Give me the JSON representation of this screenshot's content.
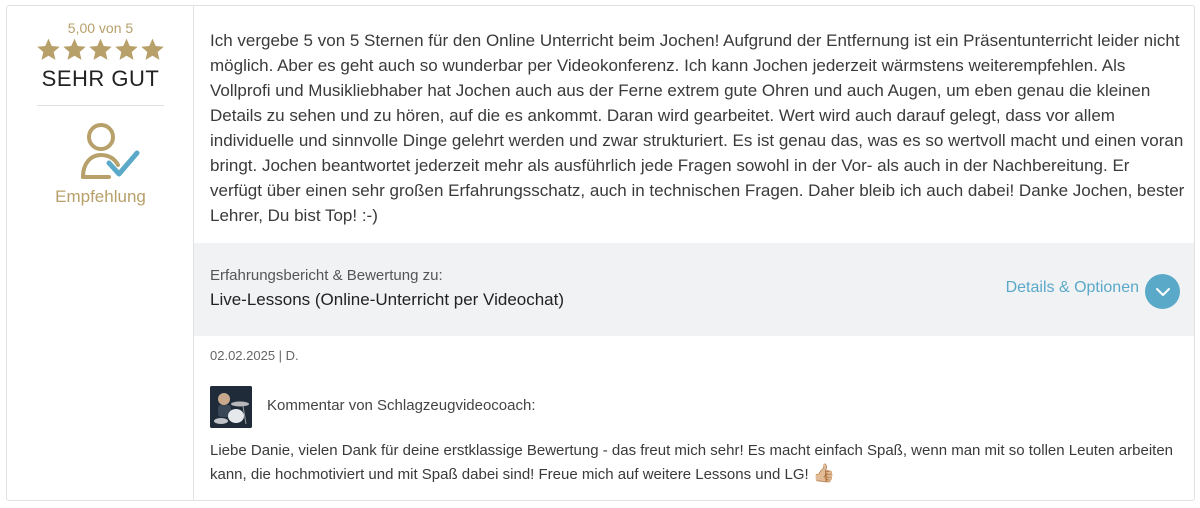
{
  "rating": {
    "score_label": "5,00 von 5",
    "stars_filled": 5,
    "stars_total": 5,
    "verdict": "SEHR GUT",
    "recommendation_label": "Empfehlung",
    "star_color": "#b8a06a",
    "check_color": "#5aa9c9"
  },
  "review": {
    "text": "Ich vergebe 5 von 5 Sternen für den Online Unterricht beim Jochen! Aufgrund der Entfernung ist ein Präsentunterricht leider nicht möglich. Aber es geht auch so wunderbar per Videokonferenz. Ich kann Jochen jederzeit wärmstens weiterempfehlen. Als Vollprofi und Musikliebhaber hat Jochen auch aus der Ferne extrem gute Ohren und auch Augen, um eben genau die kleinen Details zu sehen und zu hören, auf die es ankommt. Daran wird gearbeitet. Wert wird auch darauf gelegt, dass vor allem individuelle und sinnvolle Dinge gelehrt werden und zwar strukturiert. Es ist genau das, was es so wertvoll macht und einen voran bringt. Jochen beantwortet jederzeit mehr als ausführlich jede Fragen sowohl in der Vor- als auch in der Nachbereitung. Er verfügt über einen sehr großen Erfahrungsschatz, auch in technischen Fragen. Daher bleib ich auch dabei! Danke Jochen, bester Lehrer, Du bist Top! :-)"
  },
  "info": {
    "label": "Erfahrungsbericht & Bewertung zu:",
    "product": "Live-Lessons (Online-Unterricht per Videochat)",
    "details_label": "Details & Optionen"
  },
  "meta": {
    "date_author": "02.02.2025 | D."
  },
  "comment": {
    "author_label": "Kommentar von Schlagzeugvideocoach:",
    "text": "Liebe Danie, vielen Dank für deine erstklassige Bewertung - das freut mich sehr! Es macht einfach Spaß, wenn man mit so tollen Leuten arbeiten kann, die hochmotiviert und mit Spaß dabei sind! Freue mich auf weitere Lessons und LG!",
    "emoji": "👍🏼"
  }
}
